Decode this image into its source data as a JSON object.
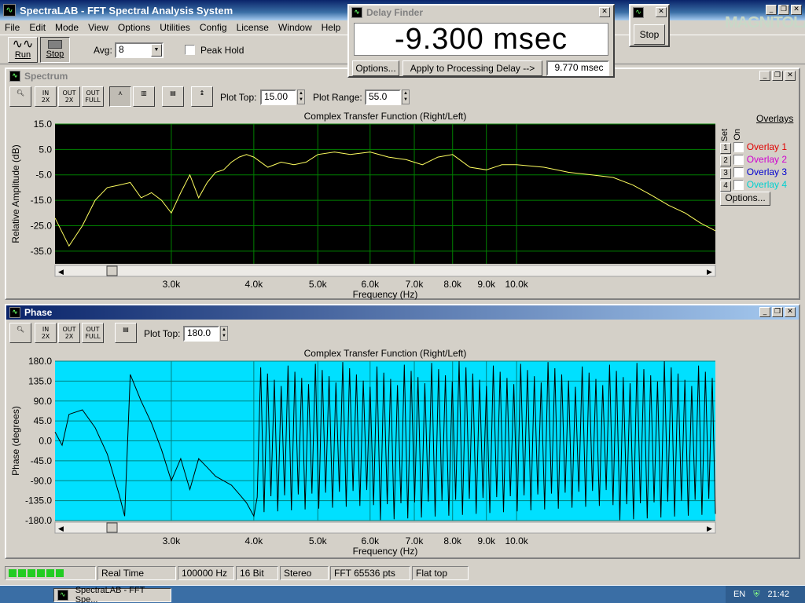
{
  "app": {
    "title": "SpectraLAB - FFT Spectral Analysis System",
    "icon": "waveform-icon"
  },
  "menu": [
    "File",
    "Edit",
    "Mode",
    "View",
    "Options",
    "Utilities",
    "Config",
    "License",
    "Window",
    "Help"
  ],
  "toolbar": {
    "run": "Run",
    "stop": "Stop",
    "avg_label": "Avg:",
    "avg_value": "8",
    "peak_hold": "Peak Hold"
  },
  "brand": "MAGNITOLA",
  "delay_finder": {
    "title": "Delay Finder",
    "value": "-9.300 msec",
    "options": "Options...",
    "apply": "Apply to Processing Delay -->",
    "delay_value": "9.770 msec"
  },
  "stop_window": {
    "button": "Stop"
  },
  "spectrum": {
    "title": "Spectrum",
    "plot_top_label": "Plot Top:",
    "plot_top": "15.00",
    "plot_range_label": "Plot Range:",
    "plot_range": "55.0",
    "overlays": {
      "header": "Overlays",
      "set": "Set",
      "on": "On",
      "items": [
        {
          "num": "1",
          "label": "Overlay 1",
          "color": "#e00000"
        },
        {
          "num": "2",
          "label": "Overlay 2",
          "color": "#d000d0"
        },
        {
          "num": "3",
          "label": "Overlay 3",
          "color": "#0000d0"
        },
        {
          "num": "4",
          "label": "Overlay 4",
          "color": "#00d0d0"
        }
      ],
      "options": "Options..."
    }
  },
  "phase": {
    "title": "Phase",
    "plot_top_label": "Plot Top:",
    "plot_top": "180.0"
  },
  "chart_data": [
    {
      "type": "line",
      "title": "Complex Transfer Function (Right/Left)",
      "xlabel": "Frequency (Hz)",
      "ylabel": "Relative Amplitude (dB)",
      "x_scale": "log",
      "xlim": [
        2000,
        20000
      ],
      "ylim": [
        -40,
        15
      ],
      "yticks": [
        "15.0",
        "5.0",
        "-5.0",
        "-15.0",
        "-25.0",
        "-35.0"
      ],
      "xtick_labels": [
        "3.0k",
        "4.0k",
        "5.0k",
        "6.0k",
        "7.0k",
        "8.0k",
        "9.0k",
        "10.0k"
      ],
      "colors": {
        "background": "#000000",
        "grid": "#008000",
        "line": "#ffff60"
      },
      "series": [
        {
          "x": [
            2000,
            2100,
            2200,
            2300,
            2400,
            2500,
            2600,
            2700,
            2800,
            2900,
            3000,
            3100,
            3200,
            3300,
            3400,
            3500,
            3600,
            3700,
            3800,
            3900,
            4000,
            4200,
            4400,
            4600,
            4800,
            5000,
            5300,
            5600,
            6000,
            6400,
            6800,
            7200,
            7600,
            8000,
            8500,
            9000,
            9500,
            10000,
            11000,
            12000,
            13000,
            14000,
            15000,
            16000,
            17000,
            18000,
            19000,
            20000
          ],
          "y": [
            -22,
            -33,
            -25,
            -15,
            -10,
            -9,
            -8,
            -14,
            -12,
            -15,
            -20,
            -12,
            -5,
            -14,
            -8,
            -4,
            -3,
            0,
            2,
            3,
            2,
            -2,
            0,
            -1,
            0,
            3,
            4,
            3,
            4,
            2,
            1,
            -1,
            2,
            3,
            -2,
            -3,
            -1,
            -1,
            -2,
            -4,
            -5,
            -6,
            -9,
            -13,
            -17,
            -20,
            -24,
            -27
          ]
        }
      ]
    },
    {
      "type": "line",
      "title": "Complex Transfer Function (Right/Left)",
      "xlabel": "Frequency (Hz)",
      "ylabel": "Phase (degrees)",
      "x_scale": "log",
      "xlim": [
        2000,
        20000
      ],
      "ylim": [
        -180,
        180
      ],
      "yticks": [
        "180.0",
        "135.0",
        "90.0",
        "45.0",
        "0.0",
        "-45.0",
        "-90.0",
        "-135.0",
        "-180.0"
      ],
      "xtick_labels": [
        "3.0k",
        "4.0k",
        "5.0k",
        "6.0k",
        "7.0k",
        "8.0k",
        "9.0k",
        "10.0k"
      ],
      "colors": {
        "background": "#00e0ff",
        "grid": "#008080",
        "line": "#000000"
      },
      "series": [
        {
          "x": [
            2000,
            2050,
            2100,
            2200,
            2300,
            2400,
            2500,
            2550,
            2600,
            2700,
            2800,
            2900,
            3000,
            3100,
            3200,
            3300,
            3400,
            3500,
            3600,
            3700,
            3800,
            3900,
            4000
          ],
          "y": [
            20,
            -10,
            60,
            70,
            30,
            -30,
            -120,
            -170,
            150,
            90,
            40,
            -20,
            -90,
            -40,
            -110,
            -40,
            -60,
            -80,
            -90,
            -100,
            -120,
            -140,
            -170
          ]
        }
      ],
      "note_wrap": "dense wrapping above 4k"
    }
  ],
  "status": {
    "realtime": "Real Time",
    "rate": "100000 Hz",
    "bits": "16 Bit",
    "channels": "Stereo",
    "fft": "FFT 65536 pts",
    "window": "Flat top"
  },
  "taskbar": {
    "task": "SpectraLAB - FFT Spe...",
    "lang": "EN",
    "clock": "21:42"
  }
}
